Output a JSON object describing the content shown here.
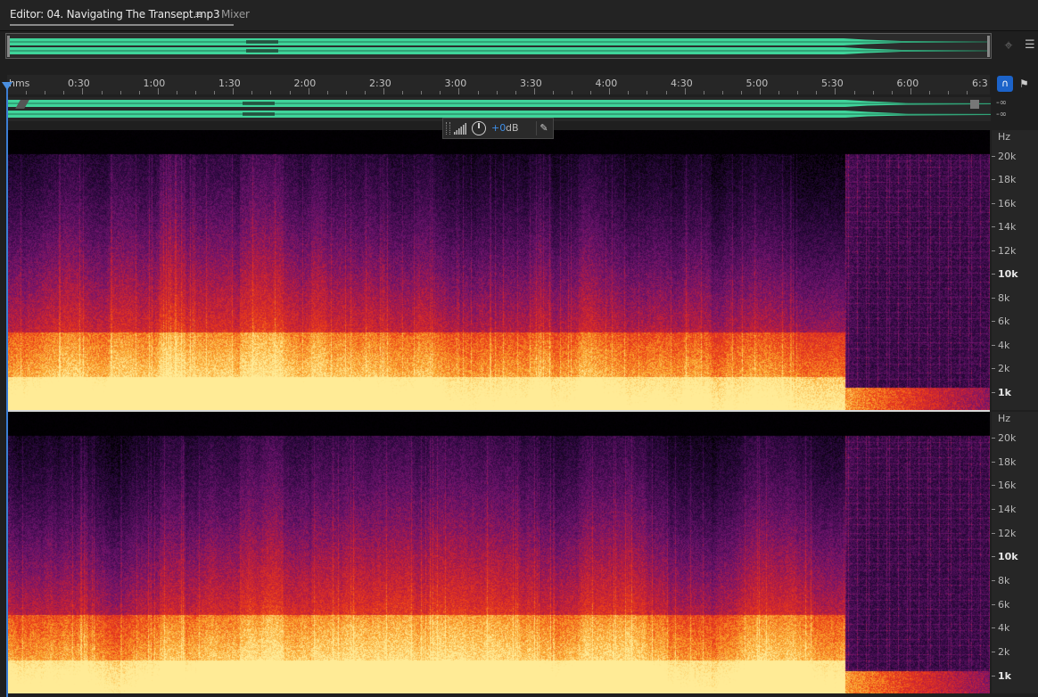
{
  "tabs": {
    "editor_label": "Editor: 04. Navigating The Transept.mp3",
    "menu_glyph": "≡",
    "mixer_label": "Mixer"
  },
  "ruler": {
    "unit_label": "hms",
    "time_labels": [
      "0:30",
      "1:00",
      "1:30",
      "2:00",
      "2:30",
      "3:00",
      "3:30",
      "4:00",
      "4:30",
      "5:00",
      "5:30",
      "6:00",
      "6:3"
    ]
  },
  "channel_levels": {
    "left": "-∞",
    "right": "-∞"
  },
  "hud": {
    "value": "+0",
    "unit": "dB"
  },
  "frequency_axis": {
    "unit": "Hz",
    "labels": [
      "20k",
      "18k",
      "16k",
      "14k",
      "12k",
      "10k",
      "8k",
      "6k",
      "4k",
      "2k",
      "1k"
    ],
    "bold_labels": [
      "10k",
      "1k"
    ]
  },
  "colors": {
    "waveform": "#3fd49a",
    "accent": "#2f80e0",
    "spectrogram_low": "#ffe38a",
    "spectrogram_mid": "#e0301e",
    "spectrogram_high": "#5a1a6e"
  },
  "icons": {
    "zoom": "crosshair-zoom-icon",
    "panel": "panel-menu-icon",
    "snap": "magnet-icon",
    "marker": "marker-icon",
    "pin": "pin-icon",
    "knob": "gain-knob-icon"
  }
}
